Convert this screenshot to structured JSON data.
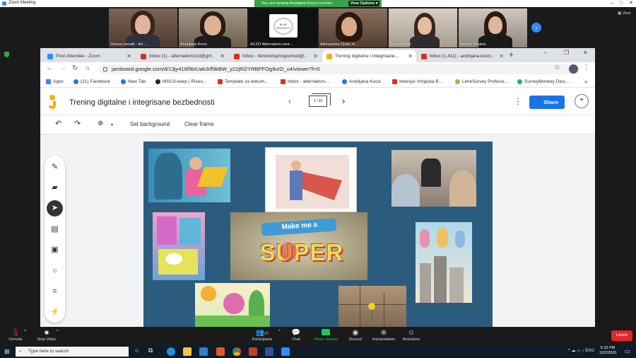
{
  "zoom": {
    "window_title": "Zoom Meeting",
    "viewing_banner": "You are viewing Andrijana Kocic's screen",
    "view_options": "View Options",
    "strip_view": "View",
    "participants": [
      {
        "name": "Venera Ismaili - Art..."
      },
      {
        "name": "Andrijana Kocic"
      },
      {
        "name": "ACZO Alternativni cent..."
      },
      {
        "name": "Aleksandra Djokic A..."
      },
      {
        "name": "Sara Đurišić"
      },
      {
        "name": "Vaitida Shukriu"
      }
    ],
    "logo_text": "BLUE PROJECT",
    "controls": [
      {
        "label": "Unmute",
        "icon": "mic-muted-icon"
      },
      {
        "label": "Stop Video",
        "icon": "video-camera-icon"
      },
      {
        "label": "Participants",
        "icon": "participants-icon",
        "count": "27"
      },
      {
        "label": "Chat",
        "icon": "chat-icon"
      },
      {
        "label": "Share Screen",
        "icon": "share-screen-icon"
      },
      {
        "label": "Record",
        "icon": "record-icon"
      },
      {
        "label": "Interpretation",
        "icon": "globe-icon"
      },
      {
        "label": "Reactions",
        "icon": "smiley-icon"
      }
    ],
    "leave_label": "Leave"
  },
  "browser": {
    "tabs": [
      {
        "label": "Post Attendee - Zoom",
        "color": "#2d8cff"
      },
      {
        "label": "Inbox (1) - alternativniczd@gm...",
        "color": "#d93025"
      },
      {
        "label": "Inbox - feministspringschool@...",
        "color": "#d93025"
      },
      {
        "label": "Trening digitalne i integrisane...",
        "color": "#f4b400"
      },
      {
        "label": "Inbox (1,411) - andrijana.kocic...",
        "color": "#d93025"
      }
    ],
    "url": "jamboard.google.com/d/13jy416f9bIUak3rlf9kBW_y22jRi2YRBPFOg9uIO_u4/viewer?f=0",
    "bookmarks": [
      {
        "label": "Apps",
        "color": "#4285f4"
      },
      {
        "label": "(21) Facebook",
        "color": "#1877f2"
      },
      {
        "label": "New Tab",
        "color": "#1877f2"
      },
      {
        "label": "MSCS-keep | Riseu...",
        "color": "#222222"
      },
      {
        "label": "Template za dokum...",
        "color": "#d93025"
      },
      {
        "label": "Inbox - alternativni...",
        "color": "#d93025"
      },
      {
        "label": "Andrijana Kocic",
        "color": "#1877f2"
      },
      {
        "label": "Intervjui Vrnjacka B...",
        "color": "#d93025"
      },
      {
        "label": "LimeSurvey Professi...",
        "color": "#8bc34a"
      },
      {
        "label": "SurveyMonkey Desi...",
        "color": "#00bf6f"
      }
    ]
  },
  "jamboard": {
    "title": "Trening digitalne i integrisane bezbednosti",
    "frame_indicator": "1 / 20",
    "share_label": "Share",
    "toolbar": {
      "set_background": "Set background",
      "clear_frame": "Clear frame"
    },
    "side_tools": [
      "pen-icon",
      "eraser-icon",
      "select-icon",
      "sticky-note-icon",
      "image-icon",
      "circle-icon",
      "text-box-icon",
      "laser-icon"
    ],
    "poster_text_1": "Make me a",
    "poster_text_2": "SUPER"
  },
  "taskbar": {
    "search_placeholder": "Type here to search",
    "time": "5:10 PM",
    "date": "12/2/2020"
  }
}
